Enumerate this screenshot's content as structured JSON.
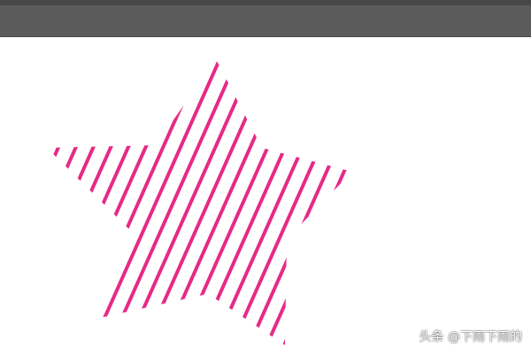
{
  "app": {
    "topbar_color": "#5b5b5b",
    "canvas_color": "#ffffff"
  },
  "artwork": {
    "shape": "star",
    "fill_pattern": "diagonal-stripes",
    "stripe_color": "#e62a86"
  },
  "watermark": {
    "text": "头条 @下雨下雨的"
  }
}
